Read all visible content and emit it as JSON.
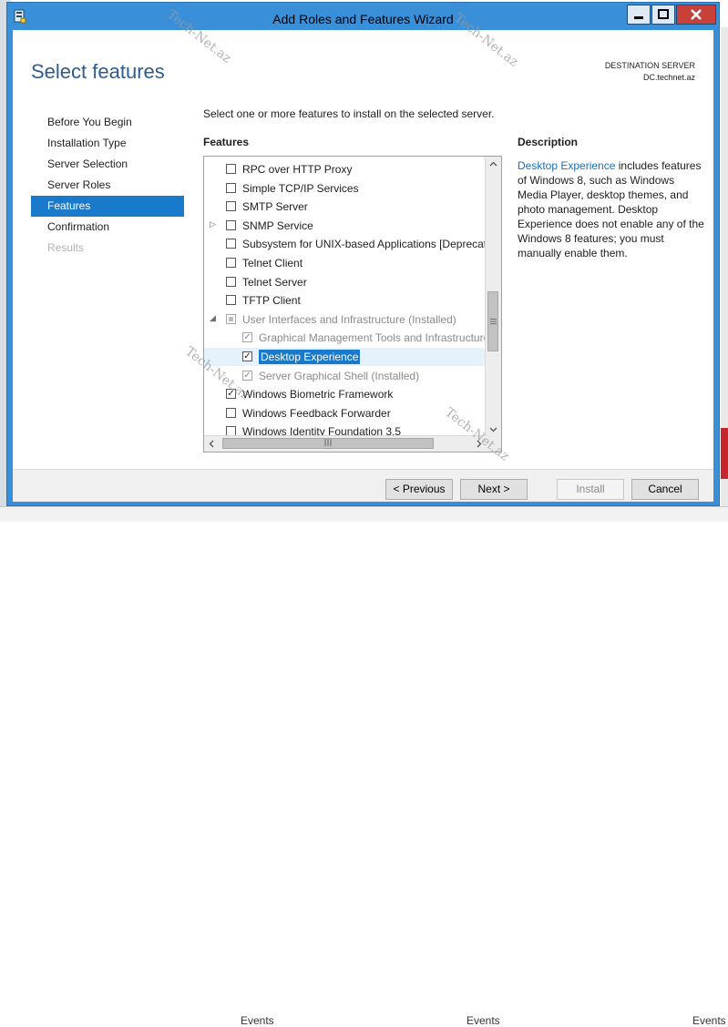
{
  "window": {
    "title": "Add Roles and Features Wizard"
  },
  "header": {
    "title": "Select features",
    "destination_label": "DESTINATION SERVER",
    "destination_value": "DC.technet.az"
  },
  "nav": {
    "items": [
      {
        "label": "Before You Begin",
        "state": "normal"
      },
      {
        "label": "Installation Type",
        "state": "normal"
      },
      {
        "label": "Server Selection",
        "state": "normal"
      },
      {
        "label": "Server Roles",
        "state": "normal"
      },
      {
        "label": "Features",
        "state": "active"
      },
      {
        "label": "Confirmation",
        "state": "normal"
      },
      {
        "label": "Results",
        "state": "disabled"
      }
    ]
  },
  "main": {
    "intro": "Select one or more features to install on the selected server.",
    "features_label": "Features",
    "features": [
      {
        "label": "RPC over HTTP Proxy",
        "checked": false
      },
      {
        "label": "Simple TCP/IP Services",
        "checked": false
      },
      {
        "label": "SMTP Server",
        "checked": false
      },
      {
        "label": "SNMP Service",
        "checked": false,
        "expander": "▷"
      },
      {
        "label": "Subsystem for UNIX-based Applications [Deprecated]",
        "checked": false
      },
      {
        "label": "Telnet Client",
        "checked": false
      },
      {
        "label": "Telnet Server",
        "checked": false
      },
      {
        "label": "TFTP Client",
        "checked": false
      },
      {
        "label": "User Interfaces and Infrastructure (Installed)",
        "checked": "partial",
        "expander": "◢",
        "gray": true
      },
      {
        "label": "Graphical Management Tools and Infrastructure",
        "checked": true,
        "gray": true,
        "child": true
      },
      {
        "label": "Desktop Experience",
        "checked": true,
        "selected": true,
        "child": true
      },
      {
        "label": "Server Graphical Shell (Installed)",
        "checked": true,
        "gray": true,
        "child": true
      },
      {
        "label": "Windows Biometric Framework",
        "checked": true
      },
      {
        "label": "Windows Feedback Forwarder",
        "checked": false
      },
      {
        "label": "Windows Identity Foundation 3.5",
        "checked": false
      }
    ]
  },
  "description": {
    "title": "Description",
    "link": "Desktop Experience",
    "text": " includes features of Windows 8, such as Windows Media Player, desktop themes, and photo management. Desktop Experience does not enable any of the Windows 8 features; you must manually enable them."
  },
  "footer": {
    "previous": "< Previous",
    "next": "Next >",
    "install": "Install",
    "cancel": "Cancel"
  },
  "background": {
    "events_label": "Events"
  },
  "watermark": "Tech-Net.az",
  "icons": {
    "window": "server-manager-icon",
    "minimize": "minimize-icon",
    "maximize": "maximize-icon",
    "close": "close-icon"
  }
}
